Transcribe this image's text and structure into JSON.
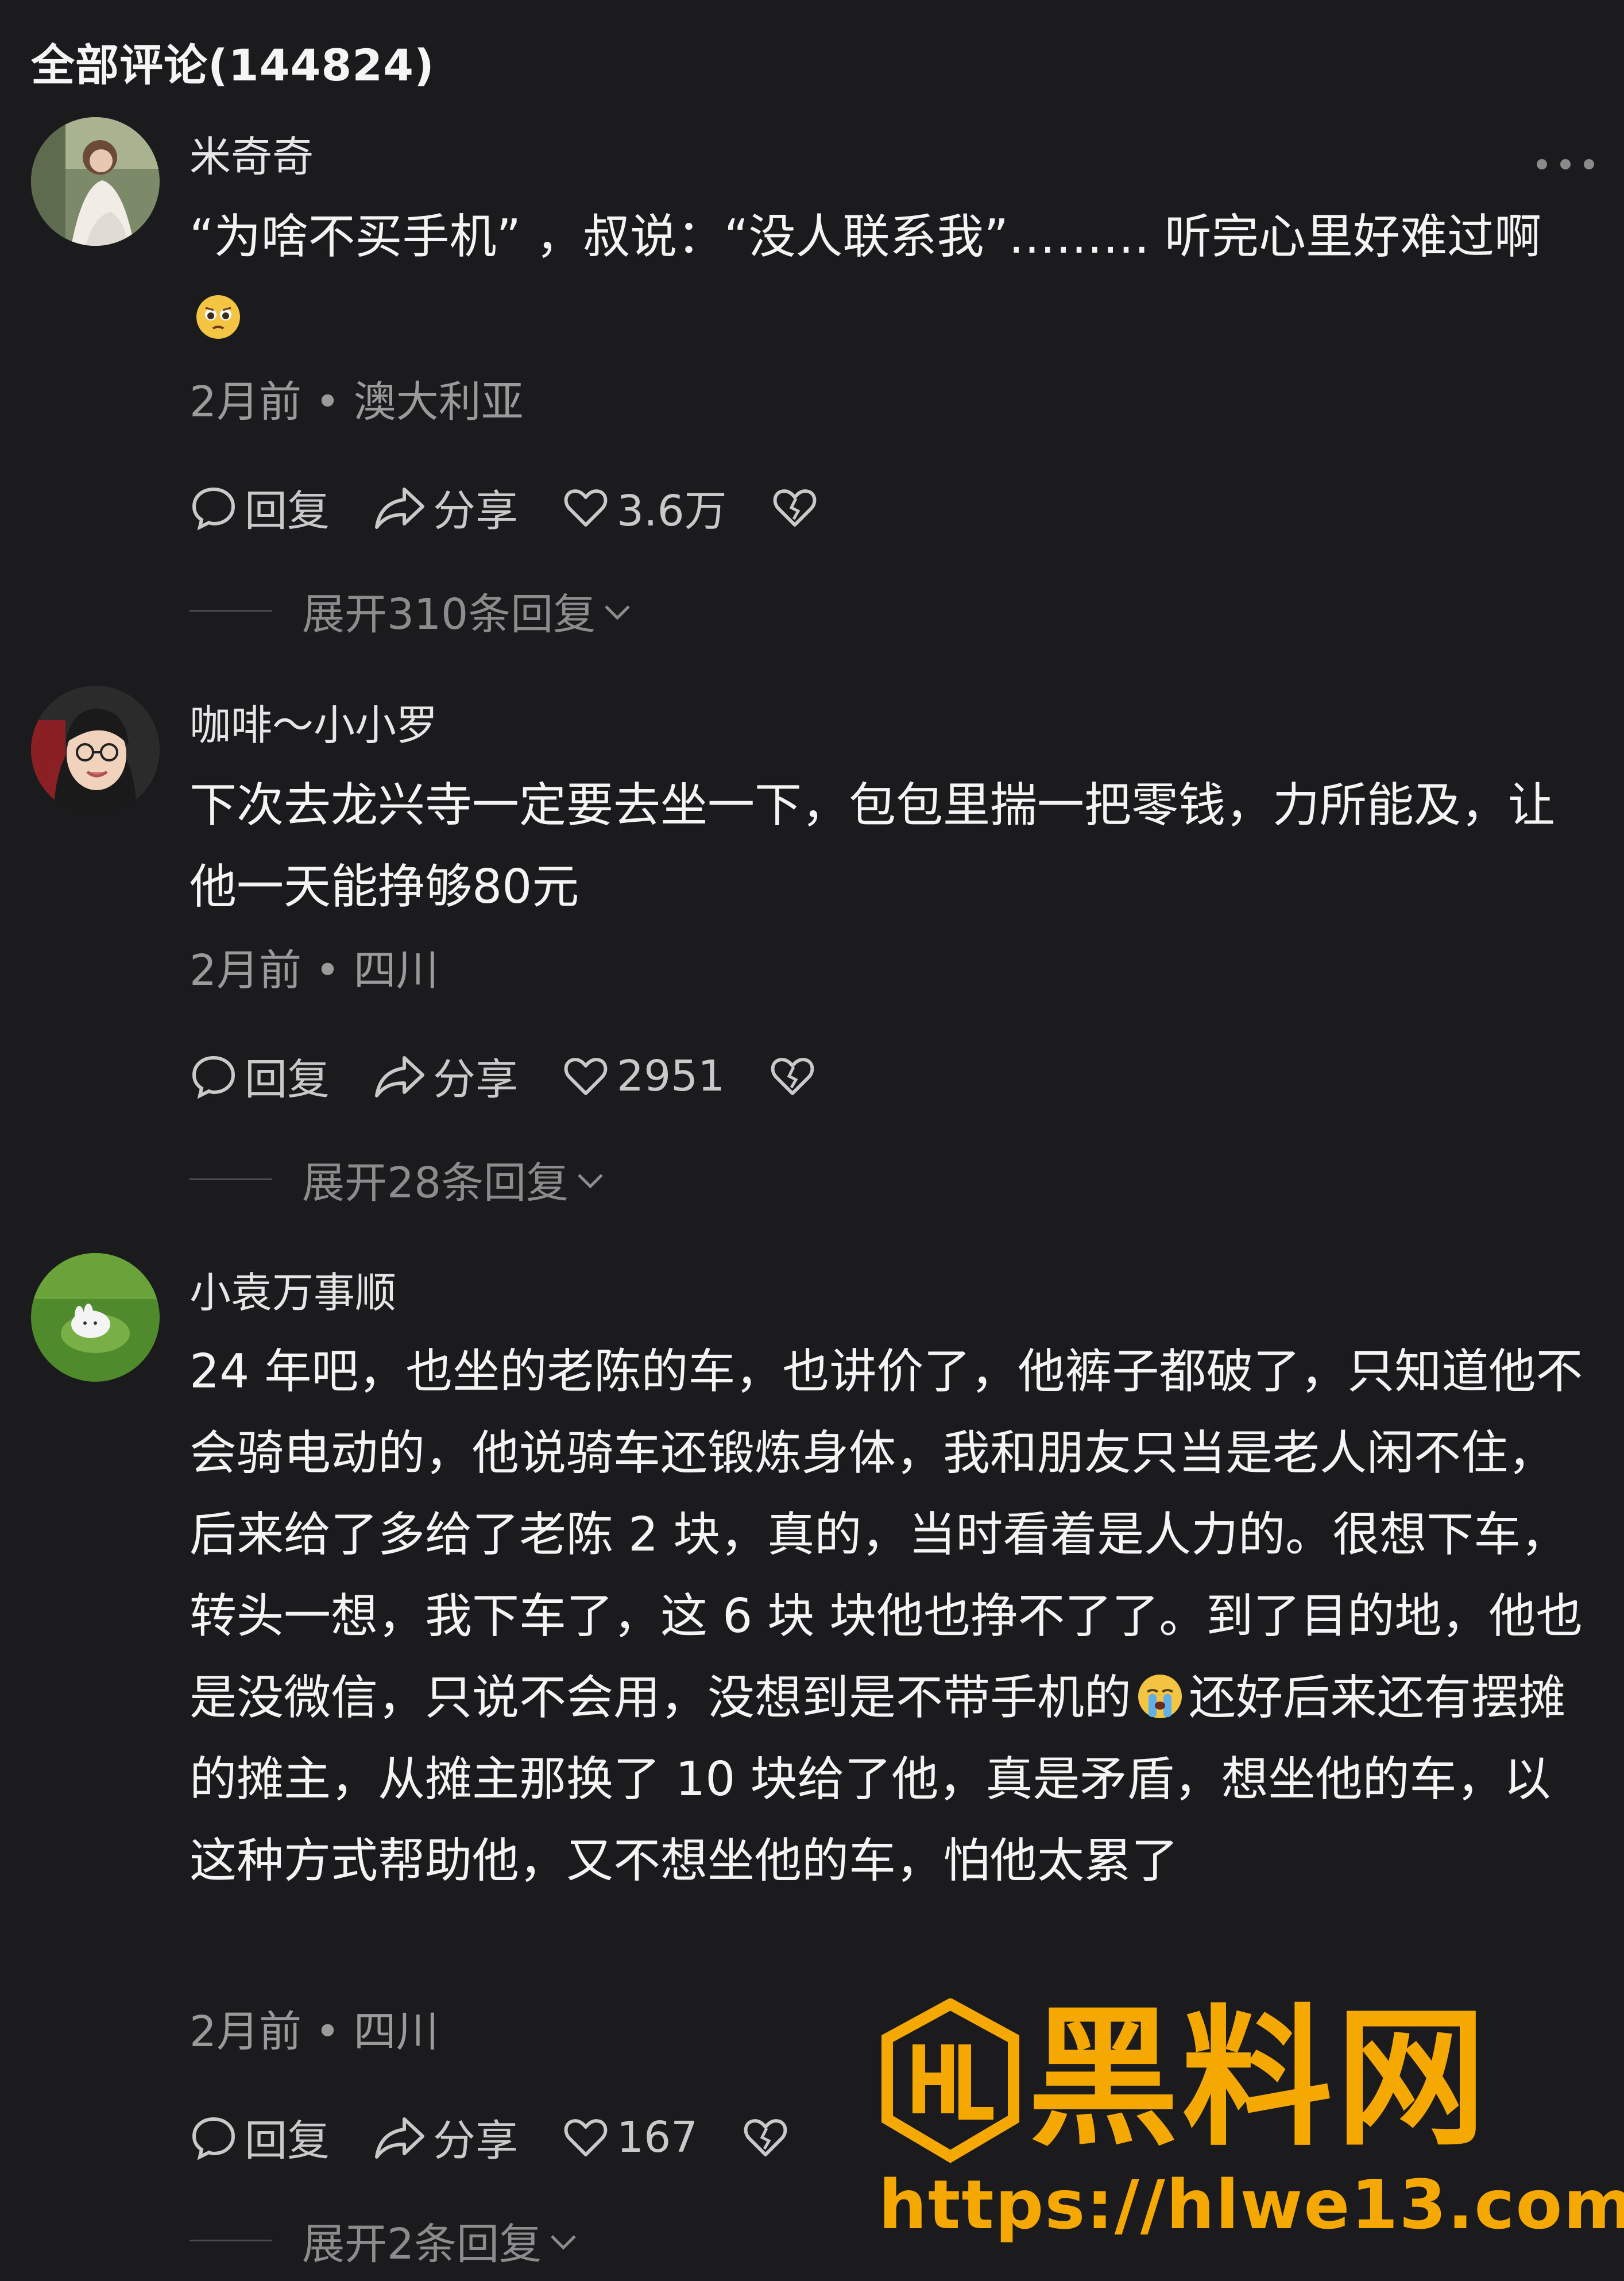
{
  "header": {
    "title": "全部评论(144824)"
  },
  "comments": [
    {
      "username": "米奇奇",
      "text_before_emoji": "“为啥不买手机” ，叔说：“没人联系我”……… 听完心里好难过啊",
      "emoji_icon": "pleading-face-emoji",
      "text_after_emoji": "",
      "time": "2月前",
      "location": "澳大利亚",
      "reply_label": "回复",
      "share_label": "分享",
      "likes": "3.6万",
      "expand_label": "展开310条回复"
    },
    {
      "username": "咖啡～小小罗",
      "text_before_emoji": "下次去龙兴寺一定要去坐一下，包包里揣一把零钱，力所能及，让他一天能挣够80元",
      "emoji_icon": "",
      "text_after_emoji": "",
      "time": "2月前",
      "location": "四川",
      "reply_label": "回复",
      "share_label": "分享",
      "likes": "2951",
      "expand_label": "展开28条回复"
    },
    {
      "username": "小袁万事顺",
      "text_before_emoji": "24 年吧，也坐的老陈的车，也讲价了，他裤子都破了，只知道他不会骑电动的，他说骑车还锻炼身体，我和朋友只当是老人闲不住，后来给了多给了老陈 2 块，真的，当时看着是人力的。很想下车，转头一想，我下车了，这 6 块 块他也挣不了了。到了目的地，他也是没微信，只说不会用，没想到是不带手机的",
      "emoji_icon": "loudly-crying-face-emoji",
      "text_after_emoji": "还好后来还有摆摊的摊主，从摊主那换了 10 块给了他，真是矛盾，想坐他的车，以这种方式帮助他，又不想坐他的车，怕他太累了",
      "time": "2月前",
      "location": "四川",
      "reply_label": "回复",
      "share_label": "分享",
      "likes": "167",
      "expand_label": "展开2条回复"
    }
  ],
  "meta_separator": " • ",
  "watermark": {
    "title": "黑料网",
    "url": "https://hlwe13.com",
    "color": "#f5a800"
  },
  "colors": {
    "background": "#1b1b1d",
    "text": "#f4f4f4",
    "secondary": "#9a9a9a"
  }
}
